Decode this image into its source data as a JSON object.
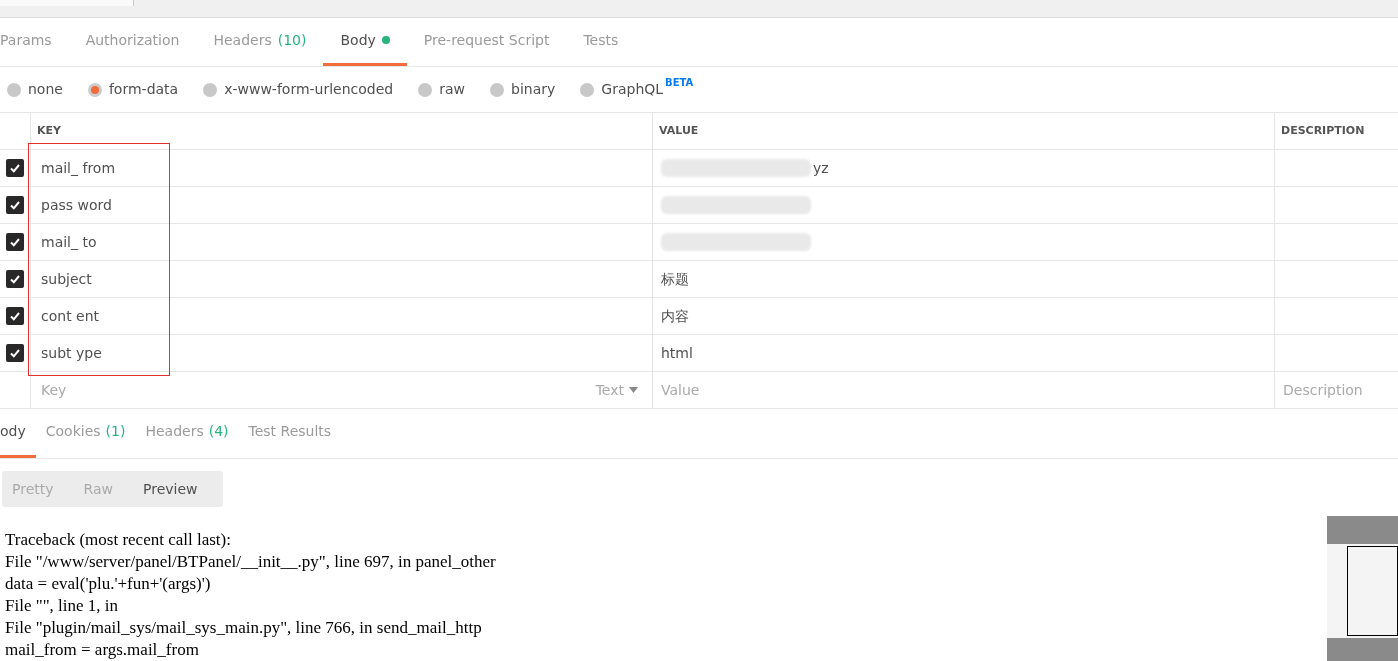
{
  "request_tabs": [
    {
      "label": "Params",
      "selected": false,
      "dot": false
    },
    {
      "label": "Authorization",
      "selected": false,
      "dot": false
    },
    {
      "label": "Headers",
      "count": "(10)",
      "selected": false,
      "dot": false
    },
    {
      "label": "Body",
      "selected": true,
      "dot": true
    },
    {
      "label": "Pre-request Script",
      "selected": false,
      "dot": false
    },
    {
      "label": "Tests",
      "selected": false,
      "dot": false
    }
  ],
  "body_types": [
    {
      "label": "none",
      "selected": false
    },
    {
      "label": "form-data",
      "selected": true
    },
    {
      "label": "x-www-form-urlencoded",
      "selected": false
    },
    {
      "label": "raw",
      "selected": false
    },
    {
      "label": "binary",
      "selected": false
    },
    {
      "label": "GraphQL",
      "selected": false,
      "badge": "BETA"
    }
  ],
  "table": {
    "columns": [
      "KEY",
      "VALUE",
      "DESCRIPTION"
    ],
    "rows": [
      {
        "checked": true,
        "key": "mail_ from",
        "value": "yz",
        "redacted": true
      },
      {
        "checked": true,
        "key": "pass word",
        "value": "",
        "redacted": true
      },
      {
        "checked": true,
        "key": "mail_ to",
        "value": "",
        "redacted": true
      },
      {
        "checked": true,
        "key": "subject",
        "value": "标题",
        "redacted": false
      },
      {
        "checked": true,
        "key": "cont ent",
        "value": "内容",
        "redacted": false
      },
      {
        "checked": true,
        "key": "subt ype",
        "value": "html",
        "redacted": false
      }
    ],
    "new_row": {
      "key_placeholder": "Key",
      "type": "Text",
      "value_placeholder": "Value",
      "description_placeholder": "Description"
    }
  },
  "response_tabs": [
    {
      "label": "ody",
      "selected": true
    },
    {
      "label": "Cookies",
      "count": "(1)",
      "selected": false
    },
    {
      "label": "Headers",
      "count": "(4)",
      "selected": false
    },
    {
      "label": "Test Results",
      "selected": false
    }
  ],
  "view_modes": [
    {
      "label": "Pretty",
      "selected": false
    },
    {
      "label": "Raw",
      "selected": false
    },
    {
      "label": "Preview",
      "selected": true
    }
  ],
  "response_lines": [
    "Traceback (most recent call last):",
    "File \"/www/server/panel/BTPanel/__init__.py\", line 697, in panel_other",
    "data = eval('plu.'+fun+'(args)')",
    "File \"\", line 1, in",
    "File \"plugin/mail_sys/mail_sys_main.py\", line 766, in send_mail_http",
    "mail_from = args.mail_from"
  ]
}
